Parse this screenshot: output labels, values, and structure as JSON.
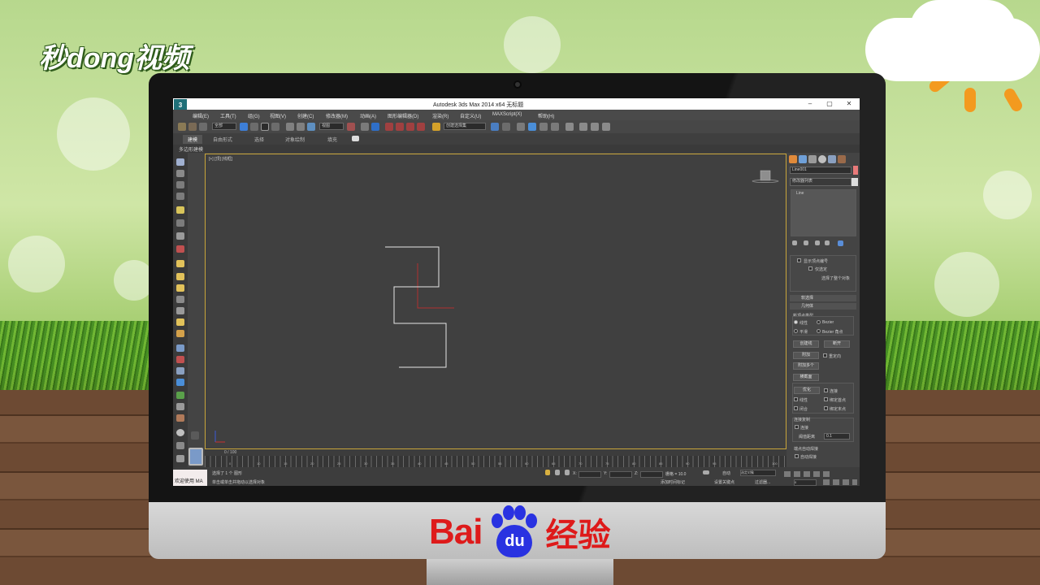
{
  "brand_top": "秒dong视频",
  "baidu": {
    "bai": "Bai",
    "du": "du",
    "jingyan": "经验"
  },
  "window": {
    "app_icon": "3",
    "title": "Autodesk 3ds Max  2014 x64     无标题",
    "minimize": "–",
    "maximize": "▢",
    "close": "✕"
  },
  "menu": [
    "编辑(E)",
    "工具(T)",
    "组(G)",
    "视图(V)",
    "创建(C)",
    "修改器(M)",
    "动画(A)",
    "图形编辑器(D)",
    "渲染(R)",
    "自定义(U)",
    "MAXScript(X)",
    "帮助(H)"
  ],
  "toolbar": {
    "selection_filter": "全部",
    "reference_coord": "视图",
    "named_selection": "创建选择集"
  },
  "ribbon": {
    "tabs": [
      "建模",
      "自由形式",
      "选择",
      "对象绘制",
      "填充"
    ],
    "active": "建模",
    "sub": "多边形建模"
  },
  "viewport": {
    "label": "[+] [顶] [线框]"
  },
  "command_panel": {
    "object_name": "Line001",
    "object_color": "#e87a7a",
    "modifier_list": "修改器列表",
    "stack_item": "Line",
    "show_vertex_numbers": "显示顶点编号",
    "selected_only": "仅选定",
    "selected_summary": "选择了整个对象",
    "rollout_soft_selection": "软选择",
    "rollout_geometry": "几何体",
    "new_vertex_type": "新顶点类型",
    "vt_linear": "线性",
    "vt_bezier": "Bezier",
    "vt_smooth": "平滑",
    "vt_bezier_corner": "Bezier 角点",
    "create_line": "创建线",
    "break": "断开",
    "attach": "附加",
    "reorient": "重定向",
    "attach_multiple": "附加多个",
    "cross_section": "横截面",
    "refine": "优化",
    "connect": "连接",
    "linear": "线性",
    "bind_first": "绑定首点",
    "closed": "闭合",
    "bind_last": "绑定末点",
    "connect_copy": "连接复制",
    "connect_chk": "连接",
    "threshold_label": "阈值距离",
    "threshold_value": "0.1",
    "end_auto_weld": "端点自动焊接",
    "auto_weld": "自动焊接"
  },
  "timeline": {
    "frame": "0 / 100",
    "ticks": [
      "0",
      "5",
      "10",
      "15",
      "20",
      "25",
      "30",
      "35",
      "40",
      "45",
      "50",
      "55",
      "60",
      "65",
      "70",
      "75",
      "80",
      "85",
      "90",
      "95",
      "100"
    ]
  },
  "status": {
    "welcome": "欢迎使用 MA",
    "selected": "选择了 1 个 图形",
    "prompt": "单击或单击并拖动以选择对象",
    "x_label": "X:",
    "y_label": "Y:",
    "z_label": "Z:",
    "grid": "栅格 = 10.0",
    "auto": "自动",
    "selected_object": "选定对象",
    "add_time_tag": "添加时间标记",
    "set_key": "设置关键点",
    "filter": "过滤器...",
    "frame_value": "0"
  }
}
